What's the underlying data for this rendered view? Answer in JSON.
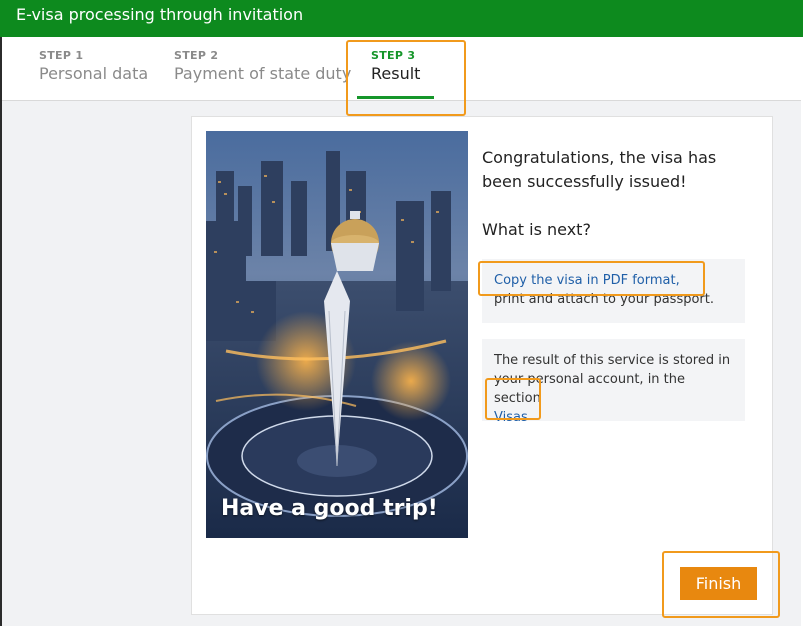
{
  "window": {
    "title": "E-visa processing through invitation"
  },
  "steps": [
    {
      "number": "STEP 1",
      "label": "Personal data"
    },
    {
      "number": "STEP 2",
      "label": "Payment of state duty"
    },
    {
      "number": "STEP 3",
      "label": "Result"
    }
  ],
  "result": {
    "image_caption": "Have a good trip!",
    "congratulations": "Congratulations, the visa has been successfully issued!",
    "next_title": "What is next?",
    "copy_visa_link": "Copy the visa in PDF format,",
    "copy_visa_rest": "print and attach to your passport.",
    "stored_text": "The result of this service is stored in your personal account, in the section",
    "visas_link": "Visas"
  },
  "actions": {
    "finish_label": "Finish"
  },
  "colors": {
    "header_green": "#0d8a1e",
    "active_step": "#16962a",
    "finish_orange": "#e8880f",
    "highlight": "#f19a1c",
    "link": "#1f5fa8"
  }
}
